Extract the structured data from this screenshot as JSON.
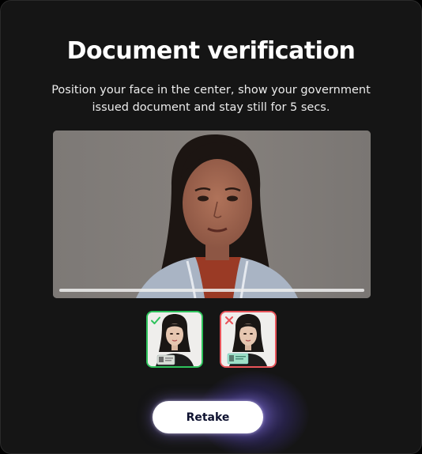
{
  "title": "Document verification",
  "instructions": {
    "line1": "Position your face in the center, show your government",
    "line2": "issued document and stay still for 5 secs."
  },
  "capture": {
    "progress": 1.0
  },
  "examples": [
    {
      "status": "correct",
      "status_icon": "check-icon",
      "color": "#2ec35c"
    },
    {
      "status": "incorrect",
      "status_icon": "cross-icon",
      "color": "#e8545a"
    }
  ],
  "actions": {
    "retake_label": "Retake"
  },
  "colors": {
    "background": "#151515",
    "correct": "#2ec35c",
    "incorrect": "#e8545a",
    "button_text": "#0e1230",
    "glow": "#8c78ff"
  }
}
